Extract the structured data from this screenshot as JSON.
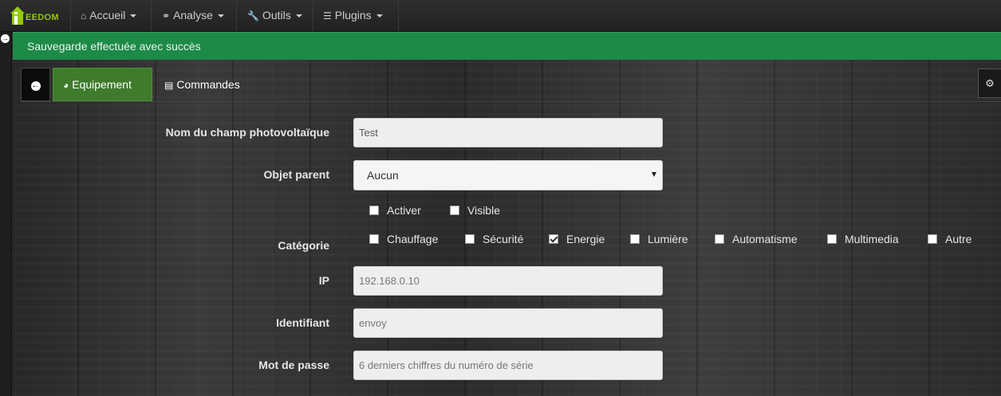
{
  "navbar": {
    "brand": "EEDOM",
    "items": [
      {
        "label": "Accueil",
        "icon": "home-icon"
      },
      {
        "label": "Analyse",
        "icon": "stethoscope-icon"
      },
      {
        "label": "Outils",
        "icon": "wrench-icon"
      },
      {
        "label": "Plugins",
        "icon": "tasks-icon"
      }
    ]
  },
  "alert": {
    "message": "Sauvegarde effectuée avec succès",
    "color": "#1d8a48"
  },
  "tabs": [
    {
      "label": "Equipement",
      "icon": "dashboard-icon",
      "active": true
    },
    {
      "label": "Commandes",
      "icon": "list-icon",
      "active": false
    }
  ],
  "form": {
    "name": {
      "label": "Nom du champ photovoltaïque",
      "value": "Test"
    },
    "parent": {
      "label": "Objet parent",
      "value": "Aucun"
    },
    "options": [
      {
        "label": "Activer",
        "checked": false
      },
      {
        "label": "Visible",
        "checked": false
      }
    ],
    "category": {
      "label": "Catégorie",
      "items": [
        {
          "label": "Chauffage",
          "checked": false
        },
        {
          "label": "Sécurité",
          "checked": false
        },
        {
          "label": "Energie",
          "checked": true
        },
        {
          "label": "Lumière",
          "checked": false
        },
        {
          "label": "Automatisme",
          "checked": false
        },
        {
          "label": "Multimedia",
          "checked": false
        },
        {
          "label": "Autre",
          "checked": false
        }
      ]
    },
    "ip": {
      "label": "IP",
      "placeholder": "192.168.0.10"
    },
    "identifier": {
      "label": "Identifiant",
      "placeholder": "envoy"
    },
    "password": {
      "label": "Mot de passe",
      "placeholder": "6 derniers chiffres du numéro de série"
    }
  },
  "accent_color": "#94ca02"
}
